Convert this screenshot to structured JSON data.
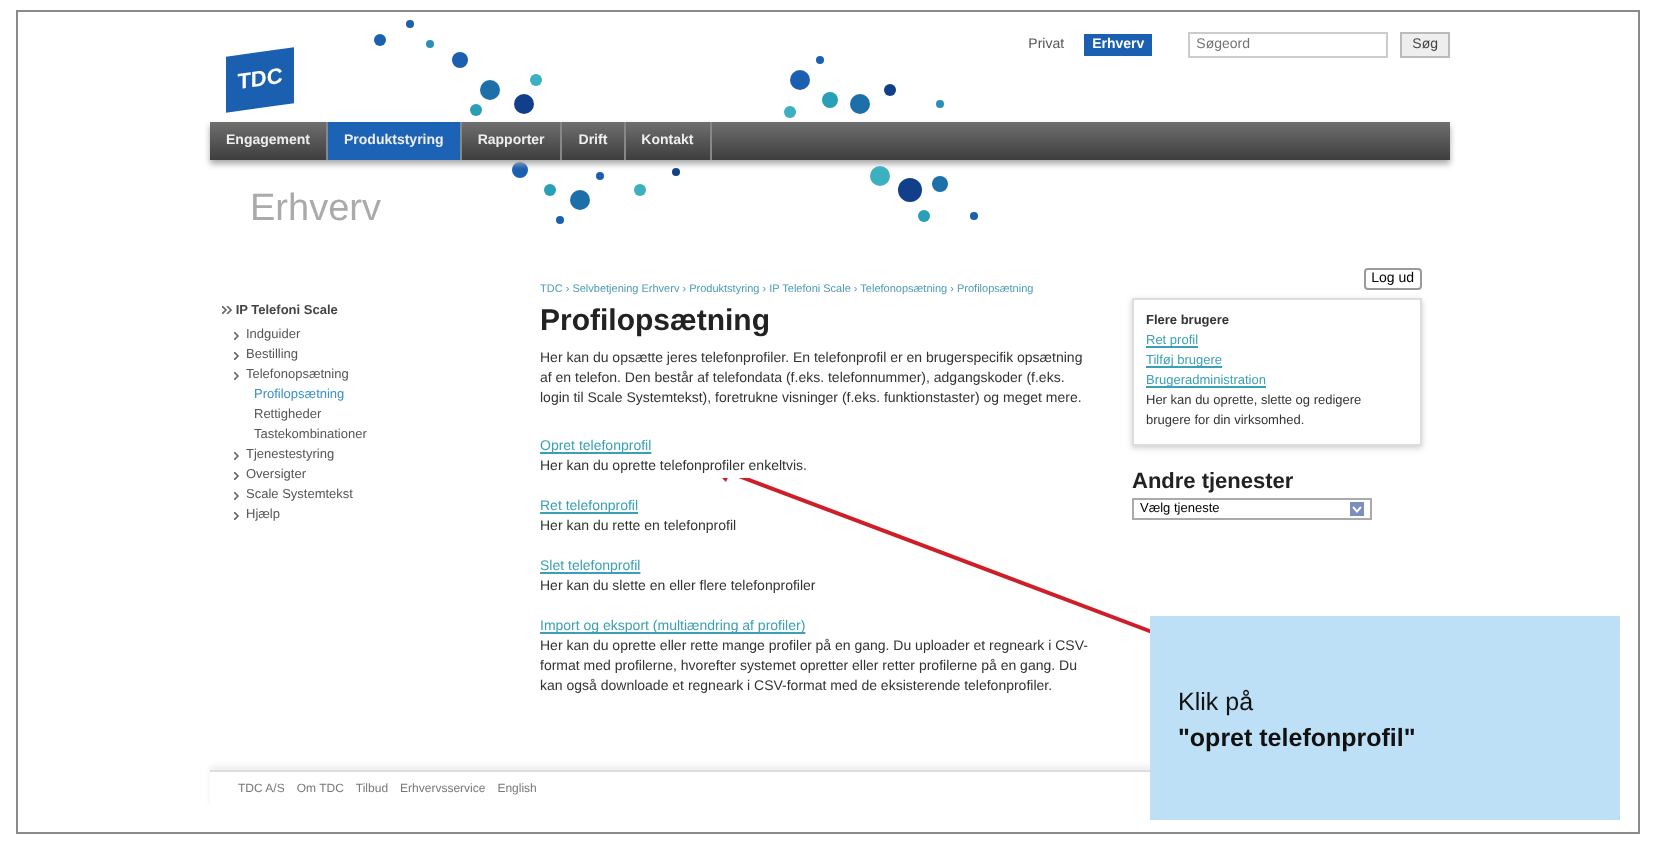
{
  "header": {
    "logo": "TDC",
    "segments": [
      {
        "label": "Privat",
        "selected": false
      },
      {
        "label": "Erhverv",
        "selected": true
      }
    ],
    "search": {
      "placeholder": "Søgeord"
    },
    "search_button": "Søg"
  },
  "nav": [
    {
      "label": "Engagement",
      "selected": false
    },
    {
      "label": "Produktstyring",
      "selected": true
    },
    {
      "label": "Rapporter",
      "selected": false
    },
    {
      "label": "Drift",
      "selected": false
    },
    {
      "label": "Kontakt",
      "selected": false
    }
  ],
  "section_title": "Erhverv",
  "sidebar": {
    "root": "IP Telefoni Scale",
    "items": [
      {
        "label": "Indguider",
        "selected": false
      },
      {
        "label": "Bestilling",
        "selected": false
      },
      {
        "label": "Telefonopsætning",
        "selected": false,
        "children": [
          {
            "label": "Profilopsætning",
            "selected": true
          },
          {
            "label": "Rettigheder",
            "selected": false
          },
          {
            "label": "Tastekombinationer",
            "selected": false
          }
        ]
      },
      {
        "label": "Tjenestestyring",
        "selected": false
      },
      {
        "label": "Oversigter",
        "selected": false
      },
      {
        "label": "Scale Systemtekst",
        "selected": false
      },
      {
        "label": "Hjælp",
        "selected": false
      }
    ]
  },
  "breadcrumb": "TDC › Selvbetjening Erhverv › Produktstyring › IP Telefoni Scale › Telefonopsætning › Profilopsætning",
  "title": "Profilopsætning",
  "intro": "Her kan du opsætte jeres telefonprofiler. En telefonprofil er en brugerspecifik opsætning af en telefon. Den består af telefondata (f.eks. telefonnummer), adgangskoder (f.eks. login til Scale Systemtekst), foretrukne visninger (f.eks. funktionstaster) og meget mere.",
  "actions": [
    {
      "link": "Opret telefonprofil",
      "text": "Her kan du oprette telefonprofiler enkeltvis."
    },
    {
      "link": "Ret telefonprofil",
      "text": "Her kan du rette en telefonprofil"
    },
    {
      "link": "Slet telefonprofil",
      "text": "Her kan du slette en eller flere telefonprofiler"
    },
    {
      "link": "Import og eksport (multiændring af profiler)",
      "text": "Her kan du oprette eller rette mange profiler på en gang. Du uploader et regneark i CSV-format med profilerne, hvorefter systemet opretter eller retter profilerne på en gang. Du kan også downloade et regneark i CSV-format med de eksisterende telefonprofiler."
    }
  ],
  "logout": "Log ud",
  "users_box": {
    "title": "Flere brugere",
    "links": [
      "Ret profil",
      "Tilføj brugere",
      "Brugeradministration"
    ],
    "text": "Her kan du oprette, slette og redigere brugere for din virksomhed."
  },
  "other_services": {
    "title": "Andre tjenester",
    "select": "Vælg tjeneste"
  },
  "footer": [
    "TDC A/S",
    "Om TDC",
    "Tilbud",
    "Erhvervsservice",
    "English"
  ],
  "callout": {
    "line1": "Klik på",
    "line2": "\"opret telefonprofil\""
  }
}
